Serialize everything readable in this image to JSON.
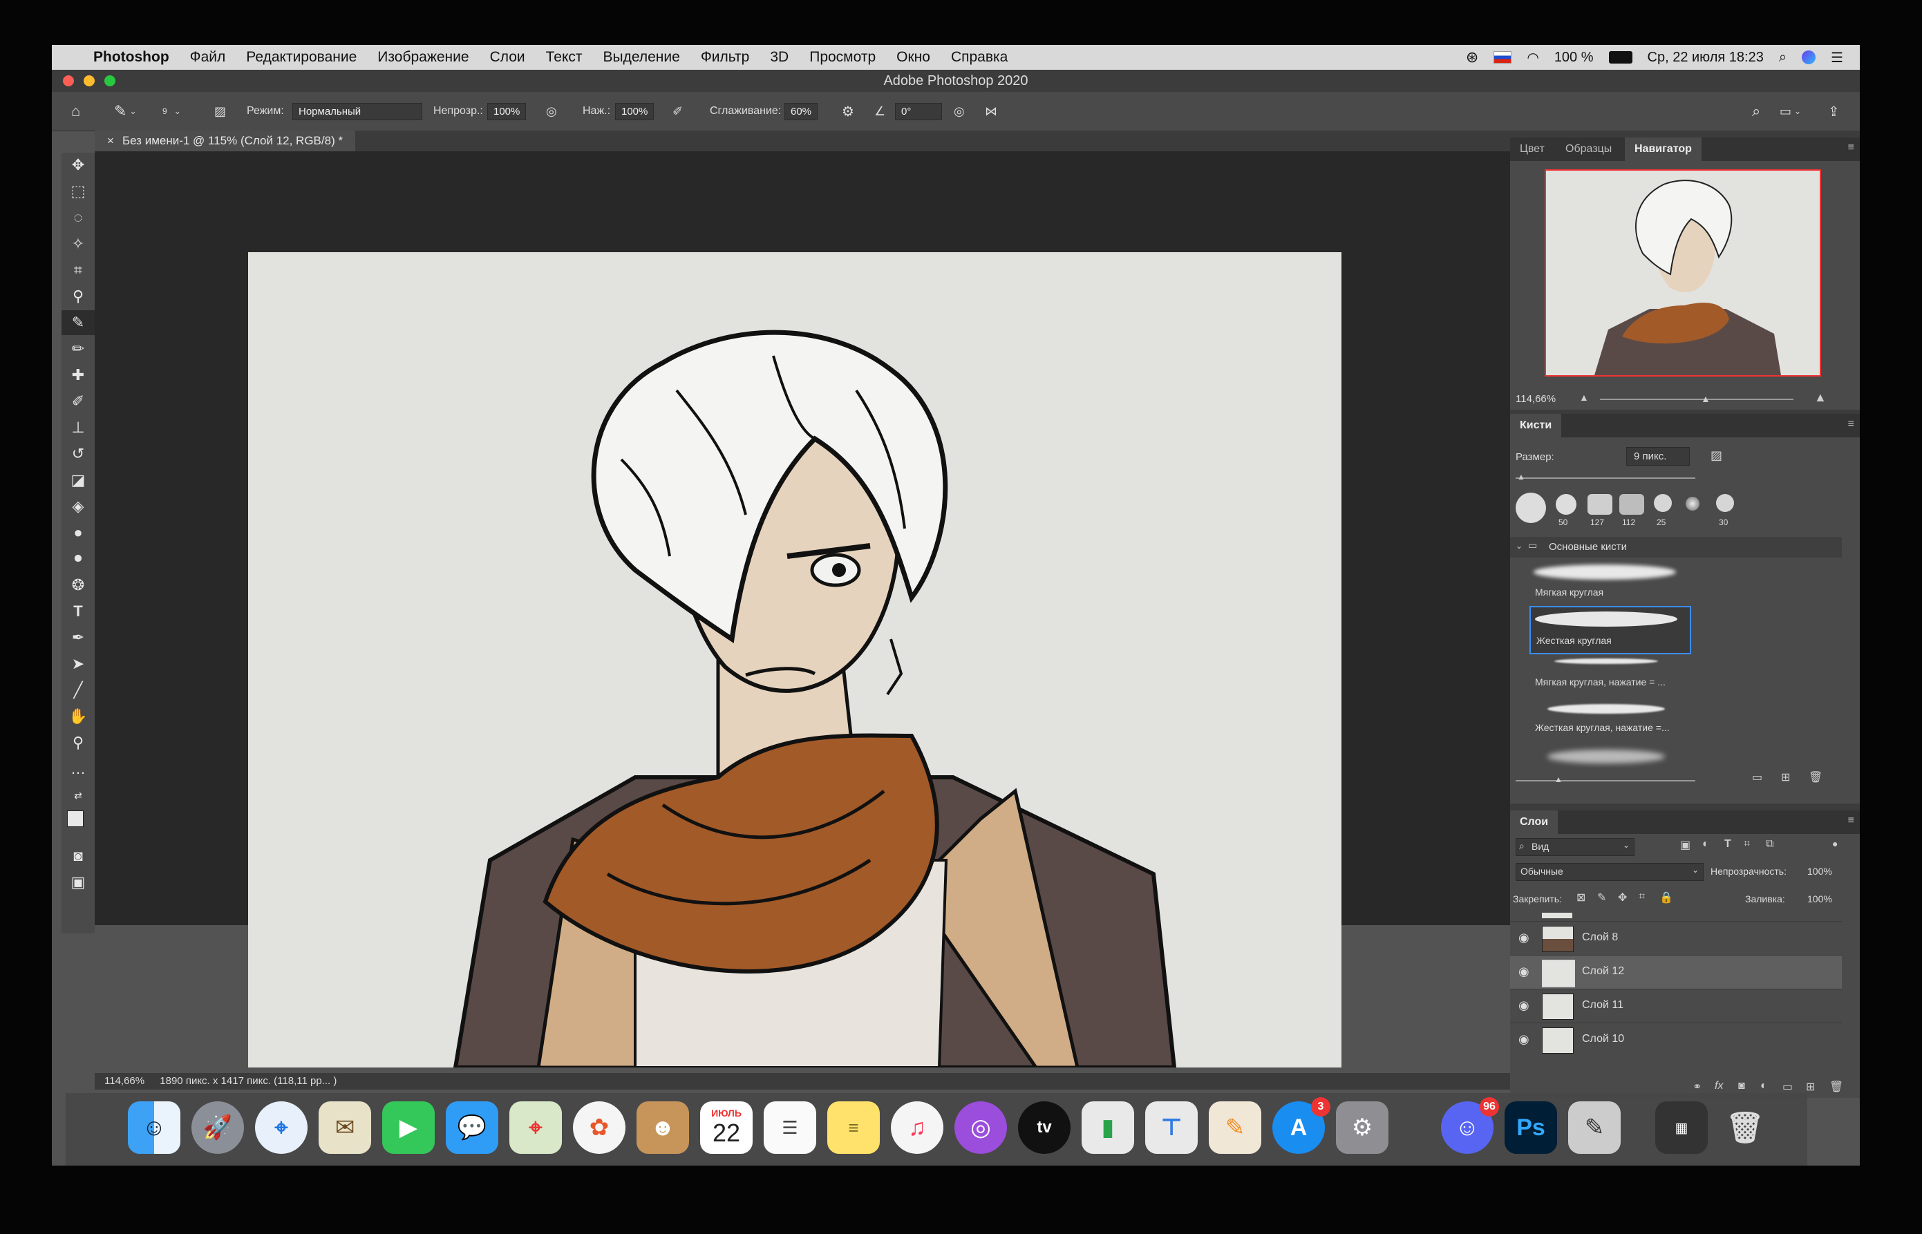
{
  "menubar": {
    "apple_icon": "apple-icon",
    "app_name": "Photoshop",
    "items": [
      "Файл",
      "Редактирование",
      "Изображение",
      "Слои",
      "Текст",
      "Выделение",
      "Фильтр",
      "3D",
      "Просмотр",
      "Окно",
      "Справка"
    ],
    "battery": "100 %",
    "datetime": "Ср, 22 июля 18:23"
  },
  "window": {
    "title": "Adobe Photoshop 2020"
  },
  "options_bar": {
    "brush_size_value": "9",
    "mode_label": "Режим:",
    "mode_value": "Нормальный",
    "opacity_label": "Непрозр.:",
    "opacity_value": "100%",
    "pressure_label": "Наж.:",
    "pressure_value": "100%",
    "smoothing_label": "Сглаживание:",
    "smoothing_value": "60%",
    "angle_value": "0°"
  },
  "document": {
    "tab_title": "Без имени-1 @ 115% (Слой 12, RGB/8) *",
    "status_zoom": "114,66%",
    "status_info": "1890 пикс. x 1417 пикс. (118,11 pp... )"
  },
  "navigator": {
    "tabs": [
      "Цвет",
      "Образцы",
      "Навигатор"
    ],
    "active_tab": "Навигатор",
    "zoom": "114,66%"
  },
  "brushes": {
    "title": "Кисти",
    "size_label": "Размер:",
    "size_value": "9 пикс.",
    "presets": [
      "",
      "50",
      "127",
      "112",
      "25",
      "",
      "30"
    ],
    "folder": "Основные кисти",
    "list": [
      "Мягкая круглая",
      "Жесткая круглая",
      "Мягкая круглая, нажатие = ...",
      "Жесткая круглая, нажатие =..."
    ],
    "selected": "Жесткая круглая"
  },
  "layers": {
    "title": "Слои",
    "filter_value": "Вид",
    "blend_value": "Обычные",
    "opacity_label": "Непрозрачность:",
    "opacity_value": "100%",
    "lock_label": "Закрепить:",
    "fill_label": "Заливка:",
    "fill_value": "100%",
    "rows": [
      "Слой 8",
      "Слой 12",
      "Слой 11",
      "Слой 10"
    ],
    "selected": "Слой 12"
  },
  "dock": {
    "calendar_month": "ИЮЛЬ",
    "calendar_day": "22",
    "appstore_badge": "3",
    "discord_badge": "96",
    "ps_label": "Ps"
  }
}
